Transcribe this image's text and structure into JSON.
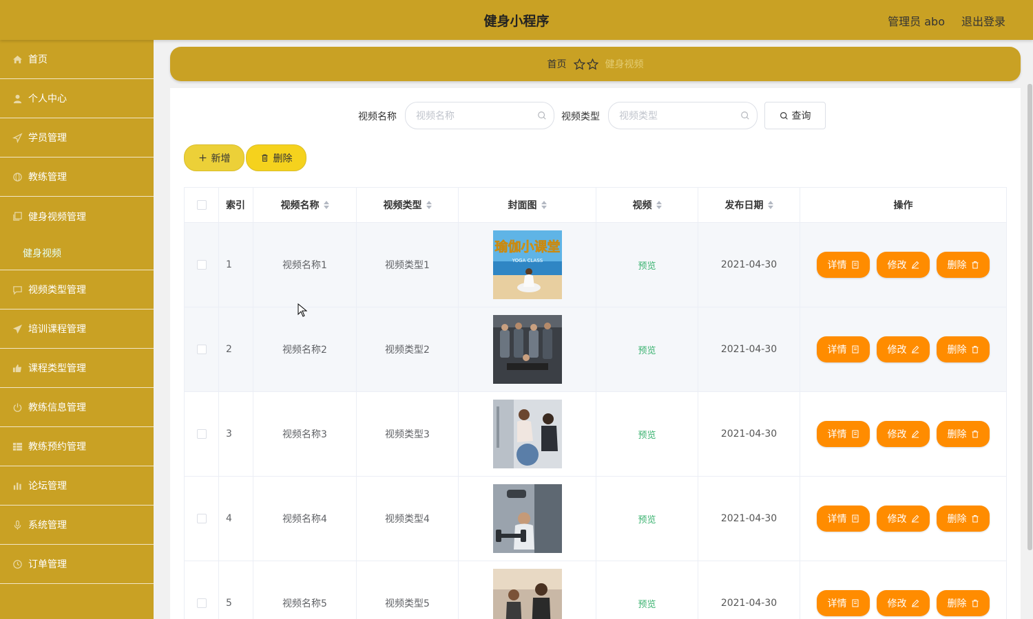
{
  "header": {
    "title": "健身小程序",
    "admin": "管理员 abo",
    "logout": "退出登录"
  },
  "sidebar": {
    "items": [
      {
        "label": "首页",
        "icon": "home-icon"
      },
      {
        "label": "个人中心",
        "icon": "user-icon"
      },
      {
        "label": "学员管理",
        "icon": "send-icon"
      },
      {
        "label": "教练管理",
        "icon": "globe-icon"
      },
      {
        "label": "健身视频管理",
        "icon": "copy-icon"
      },
      {
        "label": "视频类型管理",
        "icon": "message-icon"
      },
      {
        "label": "培训课程管理",
        "icon": "paper-plane-icon"
      },
      {
        "label": "课程类型管理",
        "icon": "thumbs-up-icon"
      },
      {
        "label": "教练信息管理",
        "icon": "power-icon"
      },
      {
        "label": "教练预约管理",
        "icon": "grid-icon"
      },
      {
        "label": "论坛管理",
        "icon": "bar-chart-icon"
      },
      {
        "label": "系统管理",
        "icon": "mic-icon"
      },
      {
        "label": "订单管理",
        "icon": "clock-icon"
      }
    ],
    "sub_item": "健身视频"
  },
  "breadcrumb": {
    "home": "首页",
    "current": "健身视频"
  },
  "search": {
    "name_label": "视频名称",
    "name_placeholder": "视频名称",
    "type_label": "视频类型",
    "type_placeholder": "视频类型",
    "query_button": "查询"
  },
  "actions": {
    "add": "新增",
    "delete": "删除"
  },
  "table": {
    "headers": {
      "index": "索引",
      "name": "视频名称",
      "type": "视频类型",
      "cover": "封面图",
      "video": "视频",
      "date": "发布日期",
      "ops": "操作"
    },
    "rows": [
      {
        "index": "1",
        "name": "视频名称1",
        "type": "视频类型1",
        "video": "预览",
        "date": "2021-04-30"
      },
      {
        "index": "2",
        "name": "视频名称2",
        "type": "视频类型2",
        "video": "预览",
        "date": "2021-04-30"
      },
      {
        "index": "3",
        "name": "视频名称3",
        "type": "视频类型3",
        "video": "预览",
        "date": "2021-04-30"
      },
      {
        "index": "4",
        "name": "视频名称4",
        "type": "视频类型4",
        "video": "预览",
        "date": "2021-04-30"
      },
      {
        "index": "5",
        "name": "视频名称5",
        "type": "视频类型5",
        "video": "预览",
        "date": "2021-04-30"
      }
    ],
    "row_buttons": {
      "detail": "详情",
      "edit": "修改",
      "delete": "删除"
    },
    "cover_texts": {
      "row1_big": "瑜伽小课堂",
      "row1_small": "YOGA CLASS"
    }
  },
  "colors": {
    "theme": "#c9a124",
    "op_button": "#ff8c00",
    "preview_link": "#3cb371"
  }
}
